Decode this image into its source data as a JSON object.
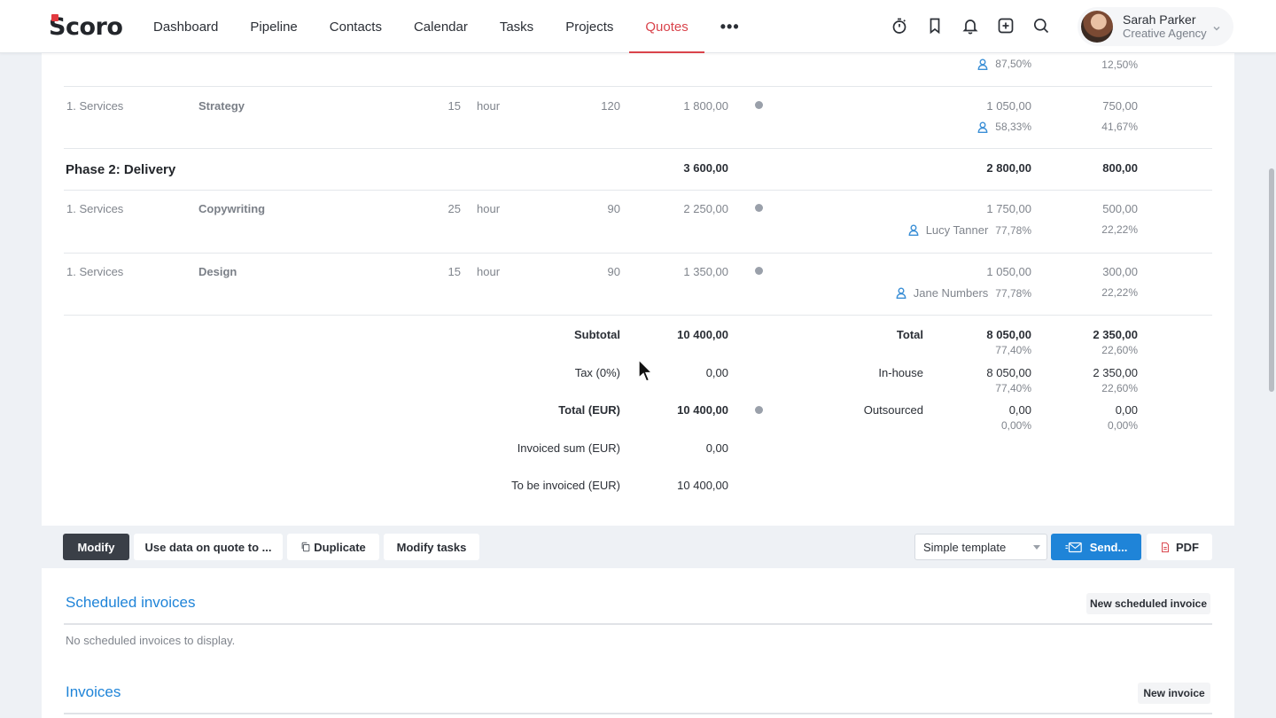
{
  "brand": {
    "logo_text": "Scoro",
    "accent": "#d9434b",
    "link_color": "#1f84d8"
  },
  "nav": {
    "items": [
      "Dashboard",
      "Pipeline",
      "Contacts",
      "Calendar",
      "Tasks",
      "Projects",
      "Quotes"
    ],
    "active": "Quotes",
    "more": "•••"
  },
  "tools": [
    "timer-icon",
    "bookmark-icon",
    "bell-icon",
    "add-icon",
    "search-icon"
  ],
  "user": {
    "name": "Sarah Parker",
    "org": "Creative Agency"
  },
  "top_partial": {
    "pct_left": "87,50%",
    "pct_right": "12,50%"
  },
  "rows": {
    "strategy": {
      "group": "1. Services",
      "name": "Strategy",
      "qty": "15",
      "unit": "hour",
      "price": "120",
      "sum": "1 800,00",
      "inhouse": "1 050,00",
      "outsourced": "750,00",
      "person": "",
      "pct_left": "58,33%",
      "pct_right": "41,67%"
    },
    "phase2": {
      "title": "Phase 2: Delivery",
      "sum": "3 600,00",
      "inhouse": "2 800,00",
      "outsourced": "800,00"
    },
    "copywriting": {
      "group": "1. Services",
      "name": "Copywriting",
      "qty": "25",
      "unit": "hour",
      "price": "90",
      "sum": "2 250,00",
      "inhouse": "1 750,00",
      "outsourced": "500,00",
      "person": "Lucy Tanner",
      "pct_left": "77,78%",
      "pct_right": "22,22%"
    },
    "design": {
      "group": "1. Services",
      "name": "Design",
      "qty": "15",
      "unit": "hour",
      "price": "90",
      "sum": "1 350,00",
      "inhouse": "1 050,00",
      "outsourced": "300,00",
      "person": "Jane Numbers",
      "pct_left": "77,78%",
      "pct_right": "22,22%"
    }
  },
  "totals": {
    "subtotal_label": "Subtotal",
    "subtotal": "10 400,00",
    "tax_label": "Tax (0%)",
    "tax": "0,00",
    "total_label": "Total (EUR)",
    "total": "10 400,00",
    "invoiced_label": "Invoiced sum (EUR)",
    "invoiced": "0,00",
    "to_invoice_label": "To be invoiced (EUR)",
    "to_invoice": "10 400,00"
  },
  "cost_summary": {
    "total_label": "Total",
    "total_in": "8 050,00",
    "total_in_pct": "77,40%",
    "total_out": "2 350,00",
    "total_out_pct": "22,60%",
    "inhouse_label": "In-house",
    "inhouse_in": "8 050,00",
    "inhouse_in_pct": "77,40%",
    "inhouse_out": "2 350,00",
    "inhouse_out_pct": "22,60%",
    "outsourced_label": "Outsourced",
    "outsourced_in": "0,00",
    "outsourced_in_pct": "0,00%",
    "outsourced_out": "0,00",
    "outsourced_out_pct": "0,00%"
  },
  "toolbar": {
    "modify": "Modify",
    "use_data": "Use data on quote to ...",
    "duplicate": "Duplicate",
    "modify_tasks": "Modify tasks",
    "template": "Simple template",
    "send": "Send...",
    "pdf": "PDF"
  },
  "scheduled": {
    "title": "Scheduled invoices",
    "new_button": "New scheduled invoice",
    "empty": "No scheduled invoices to display."
  },
  "invoices": {
    "title": "Invoices",
    "new_button": "New invoice"
  }
}
